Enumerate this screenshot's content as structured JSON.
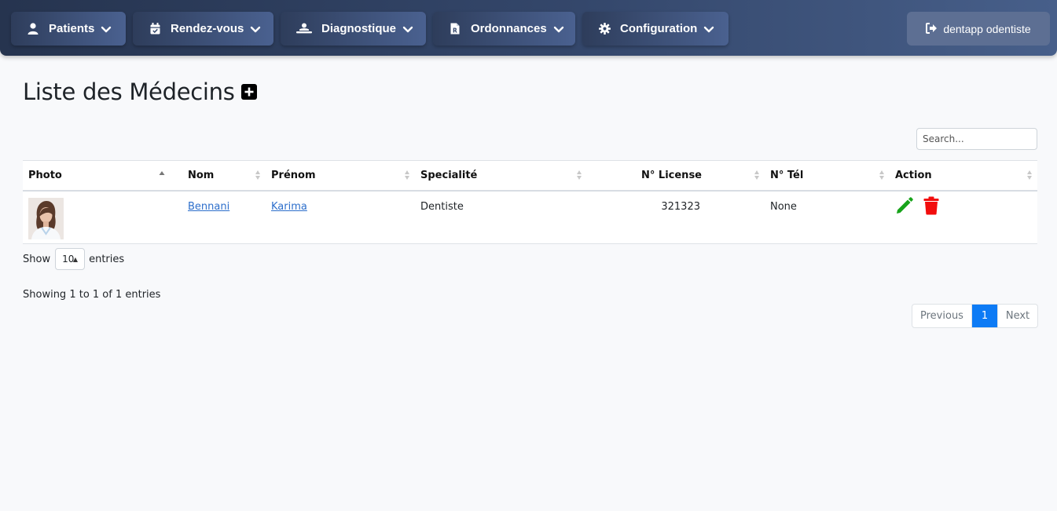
{
  "nav": {
    "items": [
      {
        "label": "Patients",
        "icon": "user-icon"
      },
      {
        "label": "Rendez-vous",
        "icon": "calendar-icon"
      },
      {
        "label": "Diagnostique",
        "icon": "hospital-bed-icon"
      },
      {
        "label": "Ordonnances",
        "icon": "prescription-icon"
      },
      {
        "label": "Configuration",
        "icon": "gear-icon"
      }
    ],
    "user_label": "dentapp odentiste"
  },
  "page": {
    "title": "Liste des Médecins"
  },
  "search": {
    "placeholder": "Search..."
  },
  "table": {
    "columns": [
      "Photo",
      "Nom",
      "Prénom",
      "Specialité",
      "N° License",
      "N° Tél",
      "Action"
    ],
    "rows": [
      {
        "nom": "Bennani",
        "prenom": "Karima",
        "specialite": "Dentiste",
        "license": "321323",
        "tel": "None"
      }
    ]
  },
  "length": {
    "show": "Show",
    "value": "10",
    "entries": "entries"
  },
  "info": "Showing 1 to 1 of 1 entries",
  "pagination": {
    "previous": "Previous",
    "current": "1",
    "next": "Next"
  },
  "colors": {
    "navbar": "#34476b",
    "edit_icon": "#17a31a",
    "delete_icon": "#f20d0d",
    "active_page": "#0d7bf5",
    "link": "#2c6ecb"
  }
}
